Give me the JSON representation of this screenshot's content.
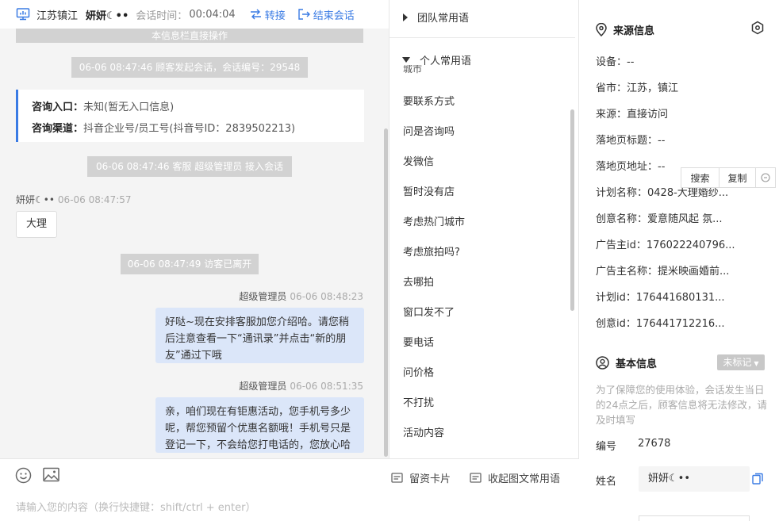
{
  "header": {
    "location": "江苏镇江",
    "customer_name": "妍妍☾••",
    "session_time_label": "会话时间：",
    "session_time": "00:04:04",
    "transfer_label": "转接",
    "end_label": "结束会话"
  },
  "chat": {
    "clipped_top_text": "本信息栏直接操作",
    "sys_start": "06-06 08:47:46 顾客发起会话，会话编号：29548",
    "entry_label": "咨询入口：",
    "entry_value": "未知(暂无入口信息)",
    "channel_label": "咨询渠道：",
    "channel_value": "抖音企业号/员工号(抖音号ID：2839502213)",
    "sys_join": "06-06 08:47:46 客服 超级管理员 接入会话",
    "visitor_name": "妍妍☾••",
    "visitor_time": "06-06 08:47:57",
    "visitor_msg": "大理",
    "sys_left": "06-06 08:47:49 访客已离开",
    "agent_name": "超级管理员",
    "agent_time_1": "06-06 08:48:23",
    "agent_msg_1": "好哒~现在安排客服加您介绍哈。请您稍后注意查看一下“通讯录”并点击“新的朋友”通过下哦",
    "agent_time_2": "06-06 08:51:35",
    "agent_msg_2": "亲，咱们现在有钜惠活动，您手机号多少呢，帮您预留个优惠名额哦！手机号只是登记一下，不会给您打电话的，您放心哈"
  },
  "composer": {
    "leave_card_label": "留资卡片",
    "collapse_label": "收起图文常用语",
    "placeholder": "请输入您的内容（换行快捷键：shift/ctrl + enter）"
  },
  "phrases": {
    "team_label": "团队常用语",
    "personal_label": "个人常用语",
    "clipped_item": "城市",
    "items": [
      "要联系方式",
      "问是咨询吗",
      "发微信",
      "暂时没有店",
      "考虑热门城市",
      "考虑旅拍吗?",
      "去哪拍",
      "窗口发不了",
      "要电话",
      "问价格",
      "不打扰",
      "活动内容"
    ]
  },
  "source": {
    "title": "来源信息",
    "device": "设备：--",
    "province": "省市：江苏，镇江",
    "from": "来源：直接访问",
    "landing_title": "落地页标题：--",
    "landing_url": "落地页地址：--",
    "search_label": "搜索",
    "copy_label": "复制",
    "plan_name": "计划名称：0428-大理婚纱...",
    "creative_name": "创意名称：爱意随风起 氛...",
    "advertiser_id": "广告主id：176022240796...",
    "advertiser_name": "广告主名称：提米映画婚前...",
    "plan_id": "计划id：176441680131...",
    "creative_id": "创意id：176441712216..."
  },
  "basic": {
    "title": "基本信息",
    "tag": "未标记",
    "note": "为了保障您的使用体验，会话发生当日的24点之后，顾客信息将无法修改，请及时填写",
    "id_label": "编号",
    "id_value": "27678",
    "name_label": "姓名",
    "name_value": "妍妍☾••"
  }
}
